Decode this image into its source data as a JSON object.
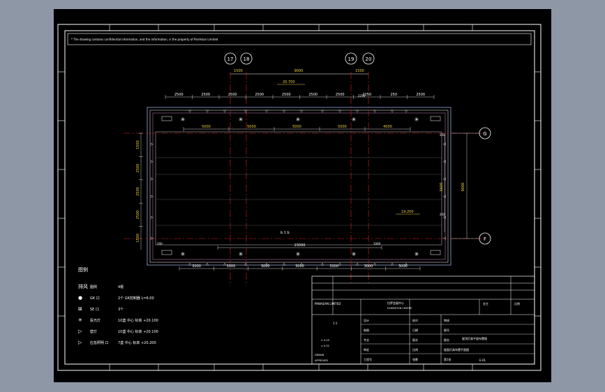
{
  "note": "* The drawing contains confidential information, and the information, is the property of PanAsian Limited",
  "axes": {
    "top": [
      {
        "label": "17"
      },
      {
        "label": "18"
      },
      {
        "label": "19"
      },
      {
        "label": "20"
      }
    ],
    "right": [
      {
        "label": "G"
      },
      {
        "label": "F"
      }
    ]
  },
  "grid_dims": [
    "1500",
    "9000",
    "1500"
  ],
  "elevations": {
    "top": "20.700",
    "interior": "19.200"
  },
  "top_dims": [
    "2500",
    "2500",
    "2500",
    "2500",
    "2500",
    "2500",
    "2500",
    "2250",
    "250",
    "2500"
  ],
  "inner_top_dims": [
    "5000",
    "5000",
    "5000",
    "5000",
    "4000"
  ],
  "bottom_dims": [
    "3000",
    "3000",
    "3000",
    "3000",
    "3000",
    "3000",
    "3000"
  ],
  "inner_bottom_dims": [
    "15000"
  ],
  "left_dims": [
    "1500",
    "2500",
    "2500",
    "2500",
    "1500"
  ],
  "right_dims": [
    "5600",
    "9000"
  ],
  "small_dims": [
    "200",
    "1000",
    "250",
    "250",
    "2250"
  ],
  "center_label": "b  1  b",
  "legend": {
    "title": "图例",
    "items": [
      {
        "symbol": "排风",
        "label": "图例",
        "desc": "4根"
      },
      {
        "symbol": "●",
        "label": "GK 口",
        "desc": "2个  GK控制器 L=6.00"
      },
      {
        "symbol": "⊠",
        "label": "SE 口",
        "desc": "3个"
      },
      {
        "symbol": "✳",
        "label": "投光灯",
        "desc": "10盏  中心 标高 +20.100"
      },
      {
        "symbol": "▷",
        "label": "壁灯",
        "desc": "10盏  中心 标高 +20.100"
      },
      {
        "symbol": "▷",
        "label": "应急照明 口",
        "desc": "7盏  中心 标高 +20.200"
      }
    ]
  },
  "title_block": {
    "company": "PANASIAN LIMITED",
    "project": "拉萨会展中心",
    "project_sub": "EXHIBITION CENTRE",
    "client": "业主",
    "scale_label": "比例",
    "scale": "1:1",
    "sheet_title": "屋顶灯具平面布置图",
    "drawing_no": "E-01",
    "rows": [
      {
        "a": "设计",
        "b": "校对",
        "c": "审核"
      },
      {
        "a": "制图",
        "b": "日期",
        "c": "图号"
      },
      {
        "a": "专业",
        "b": "版次",
        "c": "图名"
      },
      {
        "a": "审定",
        "b": "比例",
        "c": "屋面灯具布置平面图"
      },
      {
        "a": "工程号",
        "b": "张数",
        "c": "第1张"
      }
    ],
    "tolerance_1": "± 0.05",
    "tolerance_2": "± 0.02",
    "drawn": "DRAWN",
    "approved": "APPROVED"
  }
}
